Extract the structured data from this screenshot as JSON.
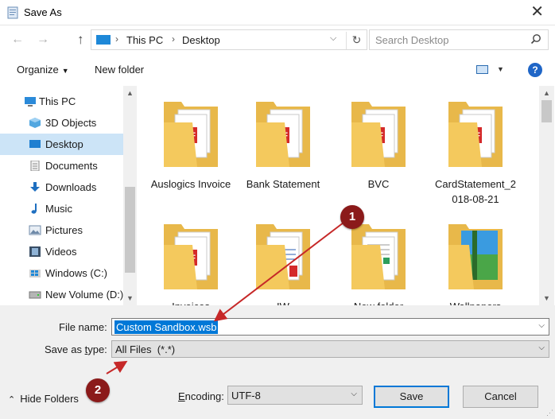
{
  "window": {
    "title": "Save As"
  },
  "address": {
    "segments": [
      "This PC",
      "Desktop"
    ]
  },
  "search": {
    "placeholder": "Search Desktop"
  },
  "toolbar": {
    "organize": "Organize",
    "new_folder": "New folder"
  },
  "nav": {
    "items": [
      {
        "label": "This PC",
        "icon": "pc-icon"
      },
      {
        "label": "3D Objects",
        "icon": "cube-icon"
      },
      {
        "label": "Desktop",
        "icon": "desktop-icon",
        "selected": true
      },
      {
        "label": "Documents",
        "icon": "documents-icon"
      },
      {
        "label": "Downloads",
        "icon": "download-arrow-icon"
      },
      {
        "label": "Music",
        "icon": "music-note-icon"
      },
      {
        "label": "Pictures",
        "icon": "pictures-icon"
      },
      {
        "label": "Videos",
        "icon": "film-icon"
      },
      {
        "label": "Windows (C:)",
        "icon": "windows-drive-icon"
      },
      {
        "label": "New Volume (D:)",
        "icon": "drive-icon"
      }
    ]
  },
  "files": [
    {
      "label": "Auslogics Invoice",
      "icon": "folder-pdf-icon"
    },
    {
      "label": "Bank Statement",
      "icon": "folder-pdf-icon"
    },
    {
      "label": "BVC",
      "icon": "folder-pdf-icon"
    },
    {
      "label": "CardStatement_2",
      "label2": "018-08-21",
      "icon": "folder-pdf-icon"
    },
    {
      "label": "Invoices",
      "icon": "folder-pdf-icon"
    },
    {
      "label": "IW",
      "icon": "folder-word-icon"
    },
    {
      "label": "New folder",
      "icon": "folder-doc-icon"
    },
    {
      "label": "Wallpapers",
      "icon": "folder-image-icon"
    }
  ],
  "form": {
    "file_name_label": "File name:",
    "file_name_value": "Custom Sandbox.wsb",
    "save_type_label_pre": "Save as ",
    "save_type_label_underlined": "t",
    "save_type_label_post": "ype:",
    "save_type_value": "All Files  (*.*)",
    "encoding_label_pre": "",
    "encoding_label_underlined": "E",
    "encoding_label_post": "ncoding:",
    "encoding_value": "UTF-8"
  },
  "footer": {
    "hide_folders": "Hide Folders",
    "save": "Save",
    "cancel": "Cancel"
  },
  "annotations": [
    {
      "number": "1"
    },
    {
      "number": "2"
    }
  ],
  "colors": {
    "accent": "#0078d7",
    "annotation": "#8b1a1a",
    "folder": "#f4c95d"
  }
}
